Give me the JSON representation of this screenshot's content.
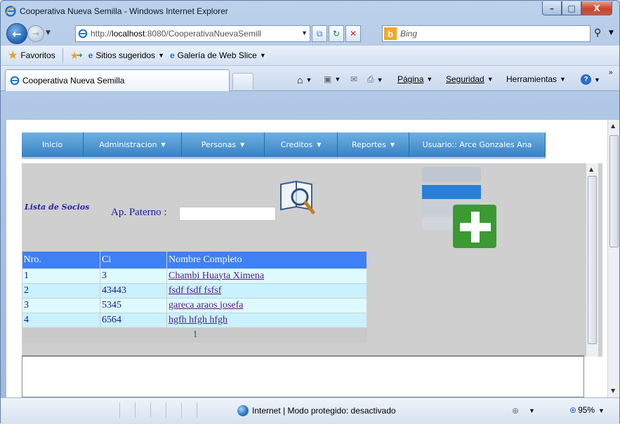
{
  "window": {
    "title": "Cooperativa Nueva Semilla - Windows Internet Explorer",
    "min_label": "–",
    "max_label": "□",
    "close_label": "X"
  },
  "address": {
    "prefix": "http://",
    "host": "localhost",
    "rest": ":8080/CooperativaNuevaSemill",
    "search_placeholder": "Bing"
  },
  "favorites": {
    "label": "Favoritos",
    "items": [
      "Sitios sugeridos",
      "Galería de Web Slice"
    ]
  },
  "tab": {
    "title": "Cooperativa Nueva Semilla"
  },
  "commands": {
    "pagina": "Página",
    "seguridad": "Seguridad",
    "herramientas": "Herramientas"
  },
  "menu": {
    "items": [
      {
        "label": "Inicio",
        "has_caret": false
      },
      {
        "label": "Administracion",
        "has_caret": true
      },
      {
        "label": "Personas",
        "has_caret": true
      },
      {
        "label": "Creditos",
        "has_caret": true
      },
      {
        "label": "Reportes",
        "has_caret": true
      },
      {
        "label": "Usuario:: Arce Gonzales Ana",
        "has_caret": false
      }
    ]
  },
  "page": {
    "list_title": "Lista de Socios",
    "ap_paterno_label": "Ap. Paterno :",
    "ap_paterno_value": ""
  },
  "table": {
    "headers": [
      "Nro.",
      "Ci",
      "Nombre Completo"
    ],
    "rows": [
      {
        "nro": "1",
        "ci": "3",
        "nombre": "Chambi Huayta Ximena"
      },
      {
        "nro": "2",
        "ci": "43443",
        "nombre": "fsdf fsdf fsfsf"
      },
      {
        "nro": "3",
        "ci": "5345",
        "nombre": "gareca araos josefa"
      },
      {
        "nro": "4",
        "ci": "6564",
        "nombre": "hgfh hfgh hfgh"
      }
    ],
    "pager": "1"
  },
  "status": {
    "zone": "Internet | Modo protegido: desactivado",
    "zoom": "95%"
  },
  "colors": {
    "menu_bar": "#3682c4",
    "table_header": "#3f80f5",
    "frame_bg": "#cfcfcf"
  }
}
